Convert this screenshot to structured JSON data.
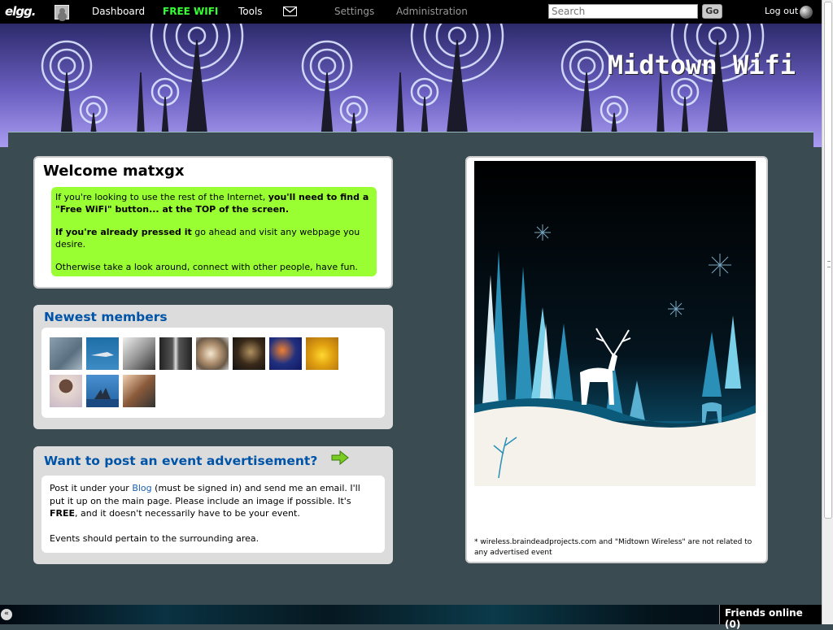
{
  "topbar": {
    "logo": "elgg.",
    "nav": {
      "dashboard": "Dashboard",
      "free_wifi": "FREE WIFI",
      "tools": "Tools",
      "settings": "Settings",
      "administration": "Administration"
    },
    "search": {
      "placeholder": "Search",
      "button": "Go"
    },
    "logout": "Log out",
    "icons": {
      "avatar": "user-avatar-icon",
      "mail": "envelope-icon",
      "logout": "power-orb-icon"
    }
  },
  "header": {
    "site_title": "Midtown Wifi"
  },
  "welcome": {
    "title": "Welcome matxgx",
    "line1_prefix": "If you're looking to use the rest of the Internet, ",
    "line1_bold": "you'll need to find a \"Free WiFi\" button... at the TOP of the screen.",
    "line2_bold": "If you're already pressed it",
    "line2_rest": " go ahead and visit any webpage you desire.",
    "line3": "Otherwise take a look around, connect with other people, have fun."
  },
  "newest_members": {
    "title": "Newest members",
    "thumbs": [
      "member-1",
      "member-2",
      "member-3",
      "member-4",
      "member-5",
      "member-6",
      "member-7",
      "member-8",
      "member-9",
      "member-10",
      "member-11"
    ]
  },
  "event_ad": {
    "title": "Want to post an event advertisement?",
    "p1_a": "Post it under your ",
    "p1_link": "Blog",
    "p1_b": " (must be signed in) and send me an email. I'll put it up on the main page. Please include an image if possible. It's ",
    "p1_bold": "FREE",
    "p1_c": ", and it doesn't necessarily have to be your event.",
    "p2": "Events should pertain to the surrounding area."
  },
  "ad_sidebar": {
    "note": "* wireless.braindeadprojects.com and \"Midtown Wireless\" are not related to any advertised event"
  },
  "bottombar": {
    "friends_online": "Friends online (0)",
    "collapse": "«"
  },
  "colors": {
    "accent_blue": "#0054a7",
    "wifi_green": "#33ff33",
    "welcome_bg": "#99ff33",
    "page_bg": "#3b4b52"
  }
}
